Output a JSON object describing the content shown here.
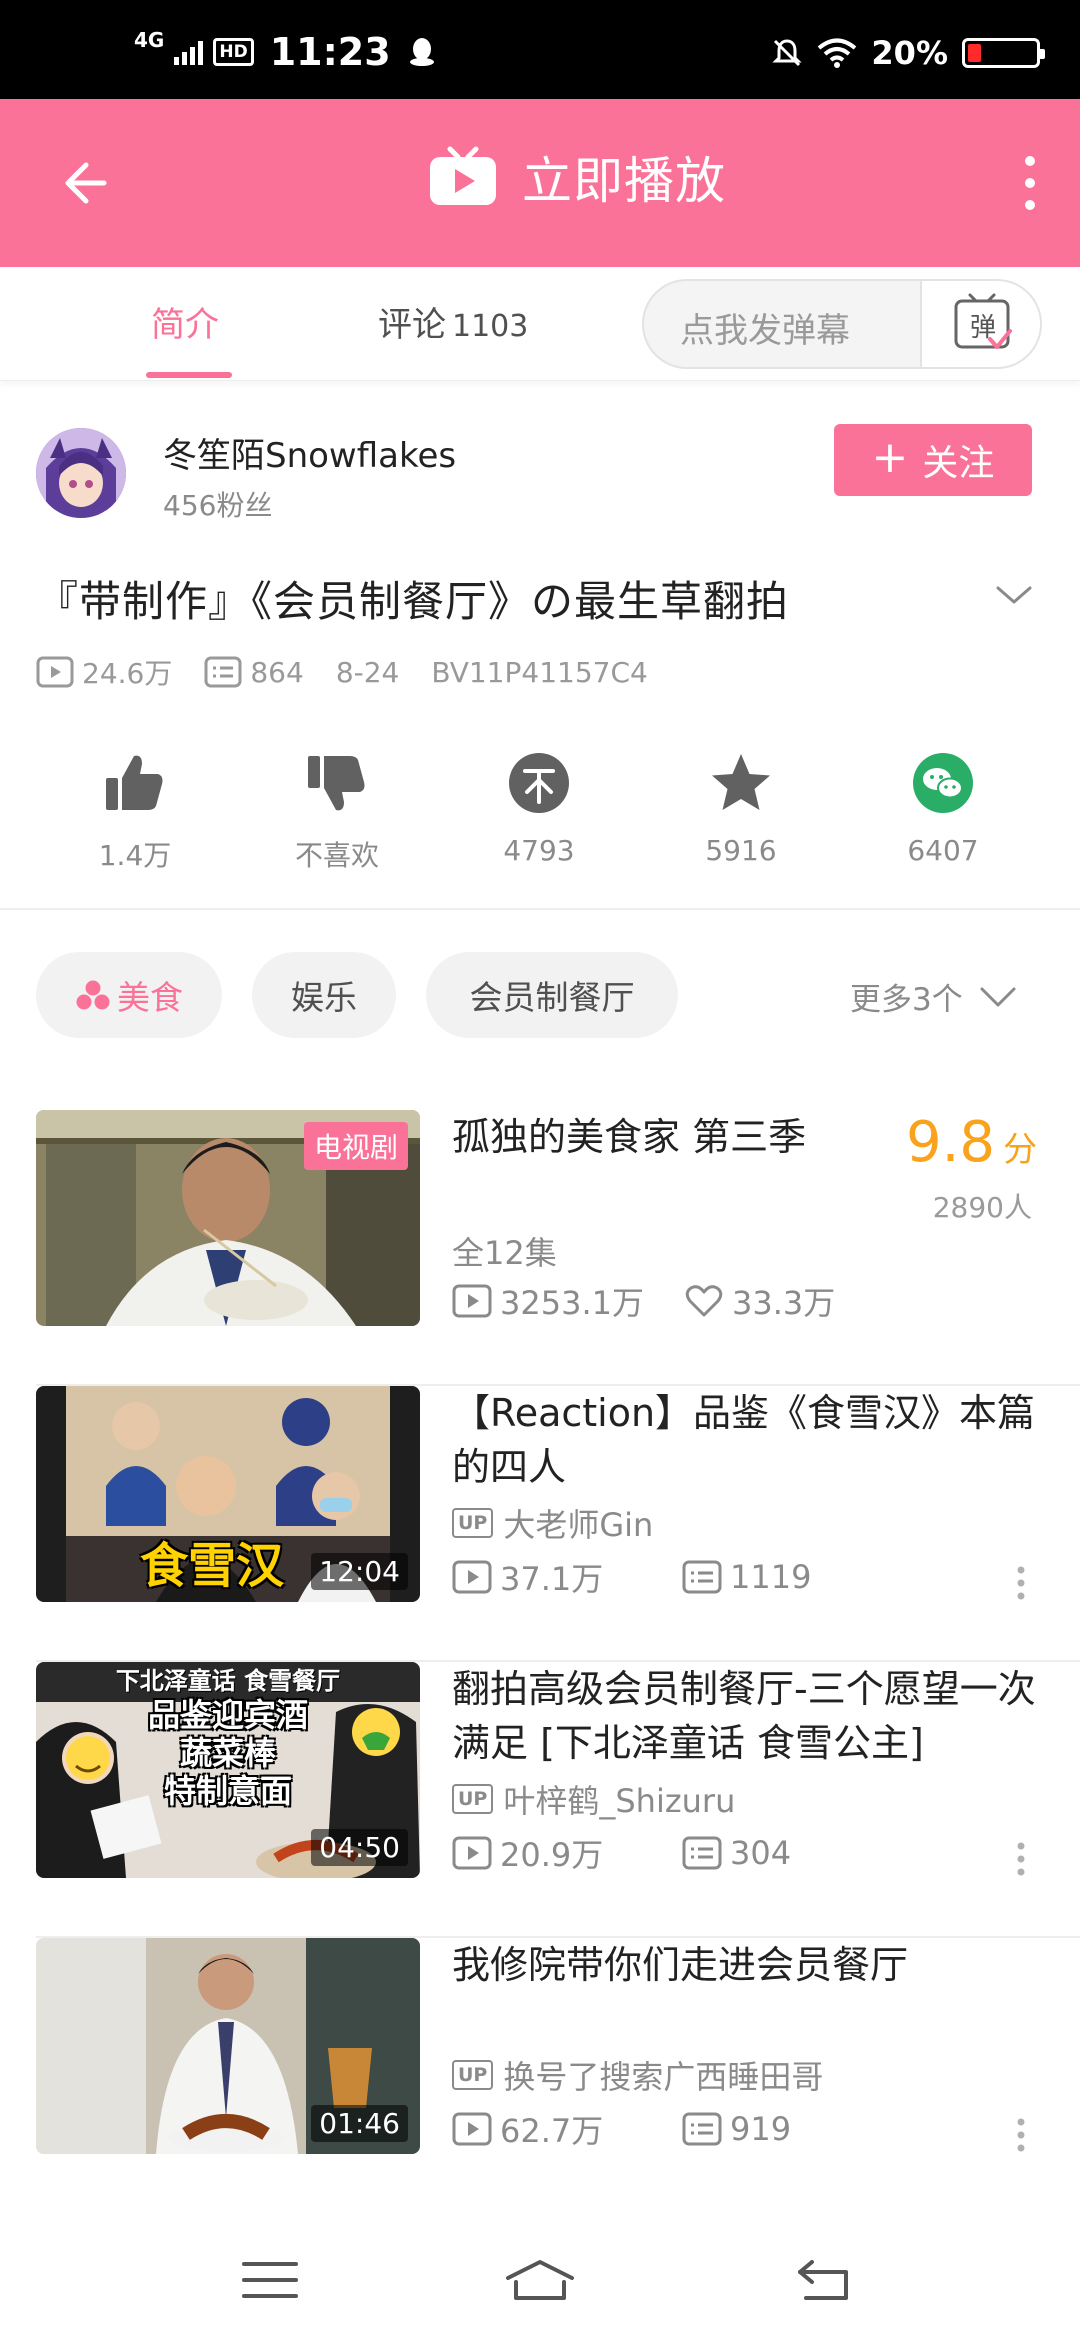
{
  "status_bar": {
    "network": "4G",
    "hd": "HD",
    "time": "11:23",
    "battery": "20%",
    "battery_level": 0.2
  },
  "header": {
    "title": "立即播放"
  },
  "tabs": {
    "intro": "简介",
    "comments": "评论",
    "comments_count": "1103",
    "danmaku_placeholder": "点我发弹幕",
    "danmaku_icon": "弹"
  },
  "uploader": {
    "name": "冬笙陌Snowflakes",
    "fans": "456粉丝",
    "follow_label": "关注"
  },
  "video": {
    "title": "『带制作』《会员制餐厅》の最生草翻拍",
    "views": "24.6万",
    "danmaku": "864",
    "date": "8-24",
    "bvid": "BV11P41157C4"
  },
  "actions": [
    {
      "icon": "thumbs-up-icon",
      "label": "1.4万"
    },
    {
      "icon": "thumbs-down-icon",
      "label": "不喜欢"
    },
    {
      "icon": "coin-icon",
      "label": "4793"
    },
    {
      "icon": "star-icon",
      "label": "5916"
    },
    {
      "icon": "wechat-icon",
      "label": "6407"
    }
  ],
  "tags": {
    "food": "美食",
    "entertainment": "娱乐",
    "club": "会员制餐厅",
    "more": "更多3个"
  },
  "recommendations": [
    {
      "badge": "电视剧",
      "title": "孤独的美食家 第三季",
      "score": "9.8",
      "score_unit": "分",
      "raters": "2890人",
      "episodes": "全12集",
      "views": "3253.1万",
      "likes": "33.3万"
    },
    {
      "title": "【Reaction】品鉴《食雪汉》本篇的四人",
      "thumb_text": "食雪汉",
      "duration": "12:04",
      "up_badge": "UP",
      "uploader": "大老师Gin",
      "views": "37.1万",
      "danmaku": "1119"
    },
    {
      "title": "翻拍高级会员制餐厅-三个愿望一次满足 [下北泽童话 食雪公主]",
      "thumb_lines": [
        "下北泽童话 食雪餐厅",
        "品鉴迎宾酒",
        "蔬菜棒",
        "特制意面"
      ],
      "duration": "04:50",
      "up_badge": "UP",
      "uploader": "叶梓鹤_Shizuru",
      "views": "20.9万",
      "danmaku": "304"
    },
    {
      "title": "我修院带你们走进会员餐厅",
      "duration": "01:46",
      "up_badge": "UP",
      "uploader": "换号了搜索广西睡田哥",
      "views": "62.7万",
      "danmaku": "919"
    }
  ],
  "colors": {
    "brand": "#fb7299",
    "score": "#f9a21b",
    "wechat": "#2aae67"
  }
}
